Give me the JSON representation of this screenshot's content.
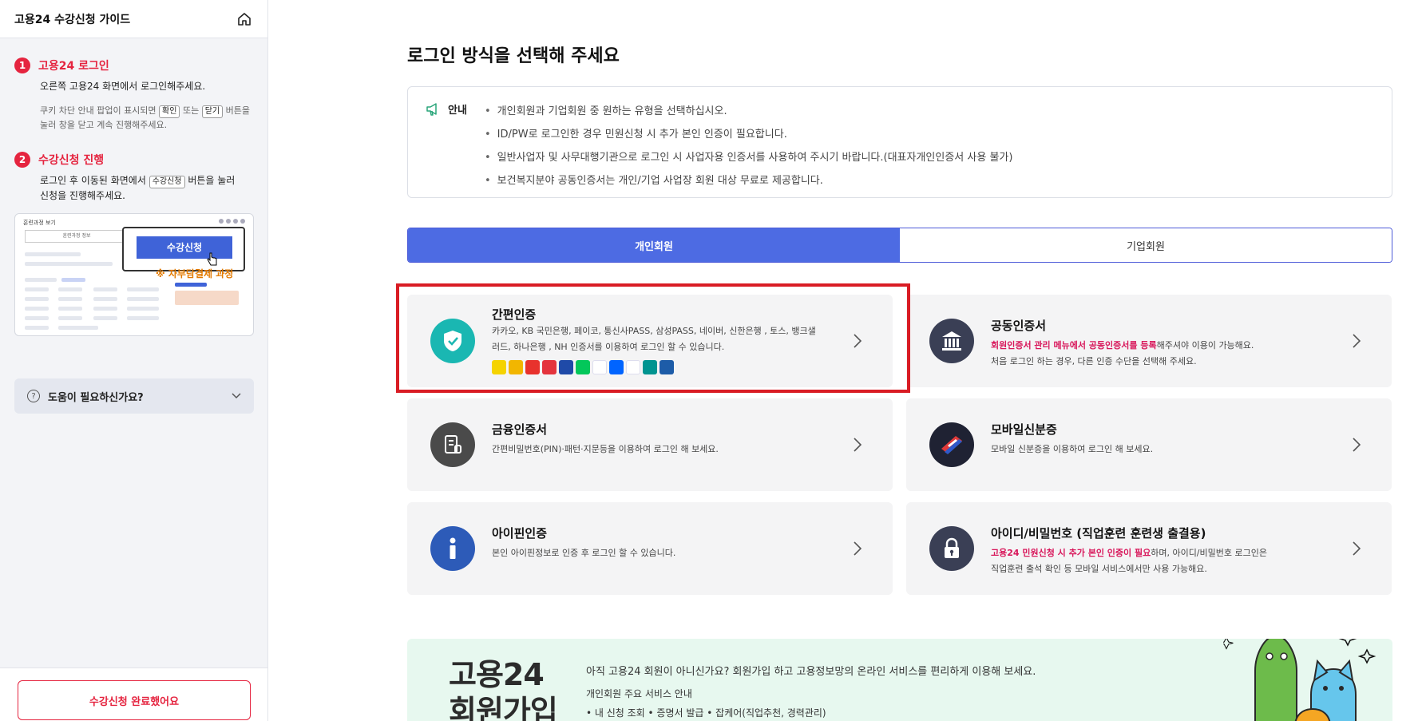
{
  "sidebar": {
    "title": "고용24 수강신청 가이드",
    "step1": {
      "num": "1",
      "title": "고용24 로그인",
      "desc": "오른쪽 고용24 화면에서 로그인해주세요.",
      "note_a": "쿠키 차단 안내 팝업이 표시되면 ",
      "note_k1": "확인",
      "note_b": " 또는 ",
      "note_k2": "닫기",
      "note_c": " 버튼을",
      "note_d": "눌러 창을 닫고 계속 진행해주세요."
    },
    "step2": {
      "num": "2",
      "title": "수강신청 진행",
      "desc_a": "로그인 후 이동된 화면에서 ",
      "desc_k": "수강신청",
      "desc_b": " 버튼을 눌러",
      "desc_c": "신청을 진행해주세요."
    },
    "thumb": {
      "top": "훈련과정 보기",
      "box": "훈련과정 정보",
      "button": "수강신청",
      "warn": "※ 자부담결제 과정"
    },
    "help": "도움이 필요하신가요?",
    "done_button": "수강신청 완료했어요"
  },
  "main": {
    "title": "로그인 방식을 선택해 주세요",
    "notice": {
      "label": "안내",
      "items": [
        "개인회원과 기업회원 중 원하는 유형을 선택하십시오.",
        "ID/PW로 로그인한 경우 민원신청 시 추가 본인 인증이 필요합니다.",
        "일반사업자 및 사무대행기관으로 로그인 시 사업자용 인증서를 사용하여 주시기 바랍니다.(대표자개인인증서 사용 불가)",
        "보건복지분야 공동인증서는 개인/기업 사업장 회원 대상 무료로 제공합니다."
      ]
    },
    "tabs": {
      "personal": "개인회원",
      "corporate": "기업회원"
    },
    "cards": {
      "simple": {
        "title": "간편인증",
        "desc": "카카오, KB 국민은행, 페이코, 통신사PASS, 삼성PASS, 네이버, 신한은행 , 토스, 뱅크샐러드, 하나은행 , NH 인증서를 이용하여 로그인 할 수 있습니다."
      },
      "joint": {
        "title": "공동인증서",
        "desc_hl": "회원인증서 관리 메뉴에서 공동인증서를 등록",
        "desc_a": "해주셔야 이용이 가능해요.",
        "desc_b": "처음 로그인 하는 경우, 다른 인증 수단을 선택해 주세요."
      },
      "finance": {
        "title": "금융인증서",
        "desc": "간편비밀번호(PIN)·패턴·지문등을 이용하여 로그인 해 보세요."
      },
      "mobile": {
        "title": "모바일신분증",
        "desc": "모바일 신분증을 이용하여 로그인 해 보세요."
      },
      "ipin": {
        "title": "아이핀인증",
        "desc": "본인 아이핀정보로 인증 후 로그인 할 수 있습니다."
      },
      "idpw": {
        "title": "아이디/비밀번호 (직업훈련 훈련생 출결용)",
        "desc_hl": "고용24 민원신청 시 추가 본인 인증이 필요",
        "desc_a": "하며, 아이디/비밀번호 로그인은",
        "desc_b": "직업훈련 출석 확인 등 모바일 서비스에서만 사용 가능해요."
      }
    },
    "signup": {
      "big_line1": "고용24",
      "big_line2": "회원가입",
      "text": "아직 고용24 회원이 아니신가요? 회원가입 하고 고용정보망의 온라인 서비스를 편리하게 이용해 보세요.",
      "sub": "개인회원 주요 서비스 안내",
      "items": "• 내 신청 조회  • 증명서 발급  • 잡케어(직업추천, 경력관리)"
    }
  },
  "colors": {
    "accent_red": "#e5243f",
    "tab_blue": "#4d6be3",
    "highlight_pink": "#d8175b",
    "selection_red": "#d91c24"
  }
}
